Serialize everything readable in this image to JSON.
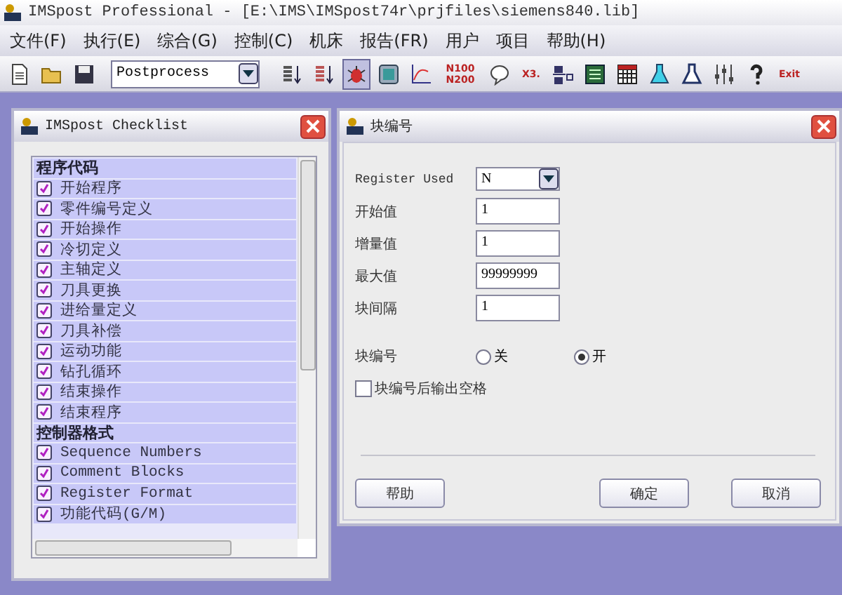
{
  "window": {
    "title": "IMSpost Professional - [E:\\IMS\\IMSpost74r\\prjfiles\\siemens840.lib]"
  },
  "menu": [
    "文件(F)",
    "执行(E)",
    "综合(G)",
    "控制(C)",
    "机床",
    "报告(FR)",
    "用户",
    "项目",
    "帮助(H)"
  ],
  "toolbar": {
    "tools_left": [
      {
        "kind": "new-file",
        "selected": false
      },
      {
        "kind": "open-folder",
        "selected": false
      },
      {
        "kind": "save",
        "selected": false
      }
    ],
    "dropdown": {
      "value": "Postprocess"
    },
    "tools_right": [
      {
        "kind": "sort-down",
        "selected": false
      },
      {
        "kind": "sort-down-red",
        "selected": false
      },
      {
        "kind": "bug",
        "selected": true
      },
      {
        "kind": "panel",
        "selected": false
      },
      {
        "kind": "graph",
        "selected": false
      },
      {
        "kind": "text",
        "label": "N100 N200",
        "selected": false
      },
      {
        "kind": "bubble",
        "selected": false
      },
      {
        "kind": "text",
        "label": "X3.",
        "selected": false
      },
      {
        "kind": "gm",
        "selected": false
      },
      {
        "kind": "green-grid",
        "selected": false
      },
      {
        "kind": "table",
        "selected": false
      },
      {
        "kind": "flask",
        "selected": false
      },
      {
        "kind": "flask-outline",
        "selected": false
      },
      {
        "kind": "sliders",
        "selected": false
      },
      {
        "kind": "help",
        "selected": false
      },
      {
        "kind": "text",
        "label": "Exit",
        "selected": false
      }
    ]
  },
  "checklist": {
    "title": "IMSpost Checklist",
    "items": [
      {
        "kind": "header",
        "label": "程序代码"
      },
      {
        "kind": "item",
        "label": "开始程序",
        "checked": true
      },
      {
        "kind": "item",
        "label": "零件编号定义",
        "checked": true
      },
      {
        "kind": "item",
        "label": "开始操作",
        "checked": true
      },
      {
        "kind": "item",
        "label": "冷切定义",
        "checked": true
      },
      {
        "kind": "item",
        "label": "主轴定义",
        "checked": true
      },
      {
        "kind": "item",
        "label": "刀具更换",
        "checked": true
      },
      {
        "kind": "item",
        "label": "进给量定义",
        "checked": true
      },
      {
        "kind": "item",
        "label": "刀具补偿",
        "checked": true
      },
      {
        "kind": "item",
        "label": "运动功能",
        "checked": true
      },
      {
        "kind": "item",
        "label": "钻孔循环",
        "checked": true
      },
      {
        "kind": "item",
        "label": "结束操作",
        "checked": true
      },
      {
        "kind": "item",
        "label": "结束程序",
        "checked": true
      },
      {
        "kind": "header",
        "label": "控制器格式"
      },
      {
        "kind": "item",
        "label": "Sequence Numbers",
        "checked": true
      },
      {
        "kind": "item",
        "label": "Comment Blocks",
        "checked": true
      },
      {
        "kind": "item",
        "label": "Register Format",
        "checked": true
      },
      {
        "kind": "item",
        "label": "功能代码(G/M)",
        "checked": true
      }
    ]
  },
  "dialog": {
    "title": "块编号",
    "register": {
      "label": "Register Used",
      "value": "N"
    },
    "fields": [
      {
        "label": "开始值",
        "value": "1"
      },
      {
        "label": "增量值",
        "value": "1"
      },
      {
        "label": "最大值",
        "value": "99999999"
      },
      {
        "label": "块间隔",
        "value": "1"
      }
    ],
    "radio": {
      "label": "块编号",
      "options": [
        {
          "label": "关",
          "selected": false
        },
        {
          "label": "开",
          "selected": true
        }
      ]
    },
    "checkbox": {
      "label": "块编号后输出空格",
      "checked": false
    },
    "buttons": [
      "帮助",
      "确定",
      "取消"
    ]
  }
}
